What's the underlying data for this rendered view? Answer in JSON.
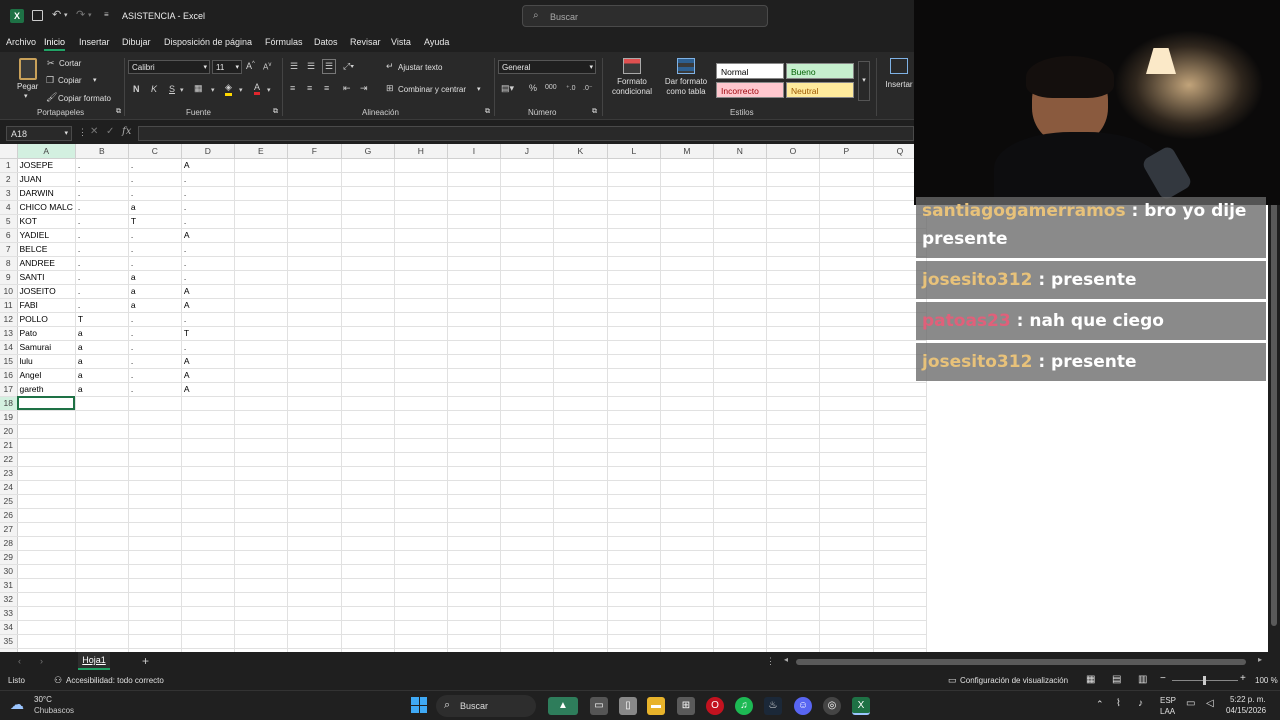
{
  "title": {
    "doc": "ASISTENCIA",
    "app": "Excel",
    "separator": "-"
  },
  "search": {
    "placeholder": "Buscar"
  },
  "menu": [
    "Archivo",
    "Inicio",
    "Insertar",
    "Dibujar",
    "Disposición de página",
    "Fórmulas",
    "Datos",
    "Revisar",
    "Vista",
    "Ayuda"
  ],
  "ribbon": {
    "paste": "Pegar",
    "cut": "Cortar",
    "copy": "Copiar",
    "format_painter": "Copiar formato",
    "clipboard": "Portapapeles",
    "font_name": "Calibri",
    "font_size": "11",
    "bold": "N",
    "italic": "K",
    "underline": "S",
    "font_group": "Fuente",
    "wrap": "Ajustar texto",
    "merge": "Combinar y centrar",
    "alignment": "Alineación",
    "number_format": "General",
    "number_group": "Número",
    "cond_format": "Formato condicional",
    "format_table": "Dar formato como tabla",
    "styles": {
      "normal": "Normal",
      "good": "Bueno",
      "bad": "Incorrecto",
      "neutral": "Neutral"
    },
    "styles_group": "Estilos",
    "insert": "Insertar"
  },
  "formula_bar": {
    "namebox": "A18",
    "fx": "fx",
    "value": ""
  },
  "columns": [
    "A",
    "B",
    "C",
    "D",
    "E",
    "F",
    "G",
    "H",
    "I",
    "J",
    "K",
    "L",
    "M",
    "N",
    "O",
    "P",
    "Q"
  ],
  "rows": [
    [
      "JOSEPE",
      ".",
      ".",
      "A"
    ],
    [
      "JUAN",
      ".",
      ".",
      "."
    ],
    [
      "DARWIN",
      ".",
      ".",
      "."
    ],
    [
      "CHICO MALC",
      ".",
      "a",
      "."
    ],
    [
      "KOT",
      ".",
      "T",
      "."
    ],
    [
      "YADIEL",
      ".",
      ".",
      "A"
    ],
    [
      "BELCE",
      ".",
      ".",
      "."
    ],
    [
      "ANDREE",
      ".",
      ".",
      "."
    ],
    [
      "SANTI",
      ".",
      "a",
      "."
    ],
    [
      "JOSEITO",
      ".",
      "a",
      "A"
    ],
    [
      "FABI",
      ".",
      "a",
      "A"
    ],
    [
      "POLLO",
      "T",
      ".",
      "."
    ],
    [
      "Pato",
      "a",
      ".",
      "T"
    ],
    [
      "Samurai",
      "a",
      ".",
      "."
    ],
    [
      "lulu",
      "a",
      ".",
      "A"
    ],
    [
      "Angel",
      "a",
      ".",
      "A"
    ],
    [
      "gareth",
      "a",
      ".",
      "A"
    ]
  ],
  "row_count": 37,
  "selected_cell": "A18",
  "sheet_tab": "Hoja1",
  "status": {
    "ready": "Listo",
    "accessibility": "Accesibilidad: todo correcto",
    "view_settings": "Configuración de visualización",
    "zoom": "100 %"
  },
  "taskbar": {
    "temp": "30°C",
    "weather": "Chubascos",
    "search": "Buscar",
    "lang": "ESP",
    "lang2": "LAA",
    "time": "5:22 p. m.",
    "date": "04/15/2026"
  },
  "chat": [
    {
      "user": "santiagogamerramos",
      "text": ": bro yo dije presente",
      "color": "#e8c27a"
    },
    {
      "user": "josesito312",
      "text": ": presente",
      "color": "#e8c27a"
    },
    {
      "user": "patoas23",
      "text": ": nah que ciego",
      "color": "#e0607a"
    },
    {
      "user": "josesito312",
      "text": ": presente",
      "color": "#e8c27a"
    }
  ],
  "colors": {
    "excel_green": "#1e7145",
    "good_bg": "#c6efce",
    "bad_bg": "#ffc7ce",
    "neutral_bg": "#ffeb9c"
  }
}
